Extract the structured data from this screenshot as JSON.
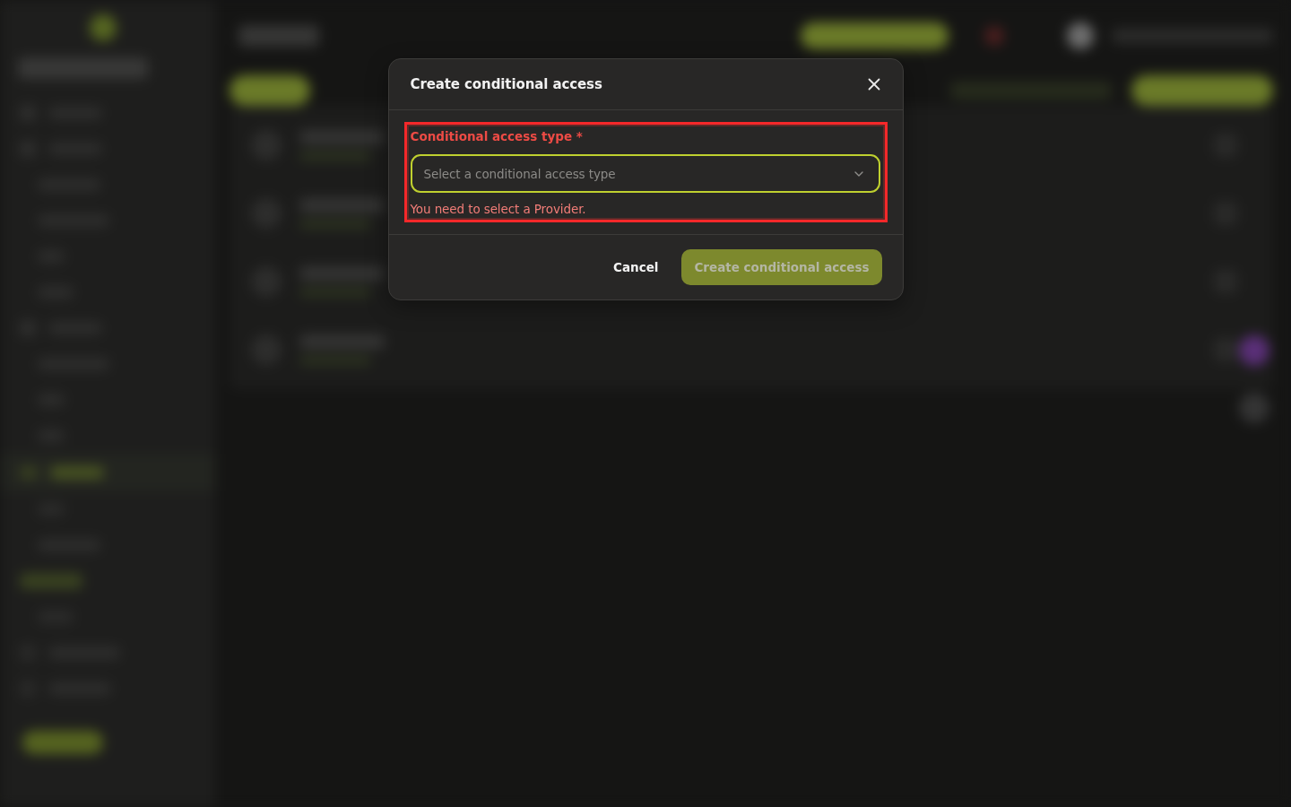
{
  "dialog": {
    "title": "Create conditional access",
    "field": {
      "label": "Conditional access type *",
      "placeholder": "Select a conditional access type",
      "error": "You need to select a Provider.",
      "highlighted": true
    },
    "buttons": [
      {
        "label": "Cancel",
        "kind": "text",
        "disabled": false
      },
      {
        "label": "Create conditional access",
        "kind": "primary",
        "disabled": true
      }
    ]
  }
}
